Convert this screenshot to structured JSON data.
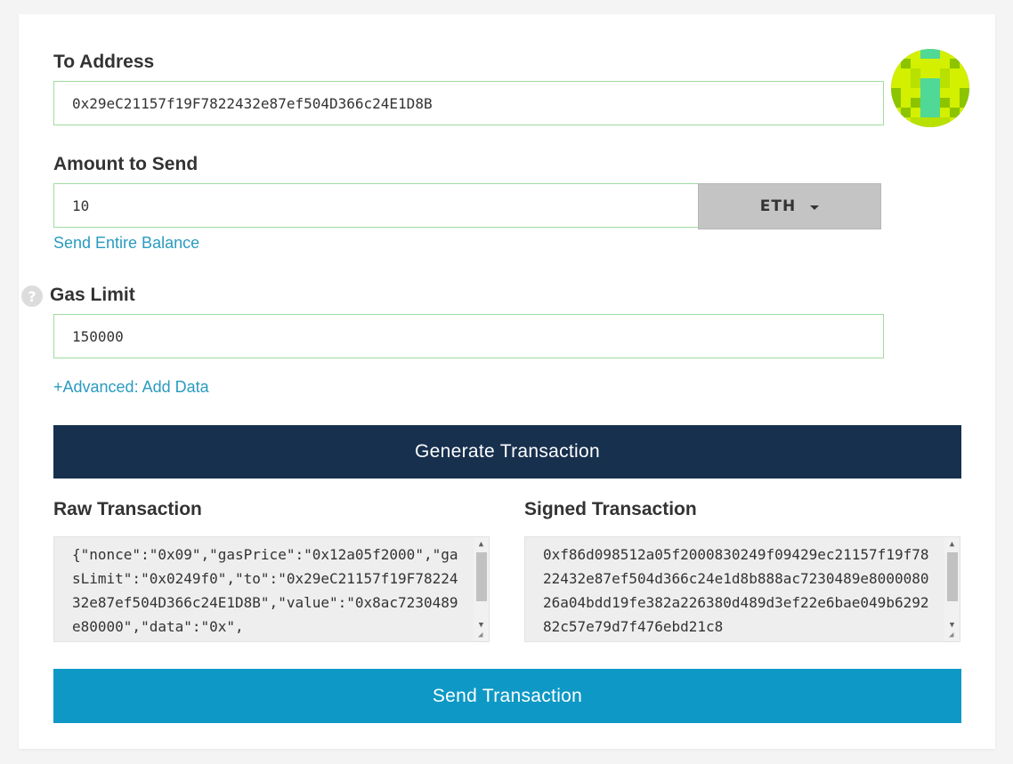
{
  "to_address": {
    "label": "To Address",
    "value": "0x29eC21157f19F7822432e87ef504D366c24E1D8B"
  },
  "amount": {
    "label": "Amount to Send",
    "value": "10",
    "unit": "ETH",
    "send_entire_balance": "Send Entire Balance"
  },
  "gas_limit": {
    "label": "Gas Limit",
    "help_icon": "?",
    "value": "150000",
    "advanced_link": "+Advanced: Add Data"
  },
  "generate_button": "Generate Transaction",
  "raw_tx": {
    "label": "Raw Transaction",
    "value": "{\"nonce\":\"0x09\",\"gasPrice\":\"0x12a05f2000\",\"gasLimit\":\"0x0249f0\",\"to\":\"0x29eC21157f19F7822432e87ef504D366c24E1D8B\",\"value\":\"0x8ac7230489e80000\",\"data\":\"0x\","
  },
  "signed_tx": {
    "label": "Signed Transaction",
    "value": "0xf86d098512a05f2000830249f09429ec21157f19f7822432e87ef504d366c24e1d8b888ac7230489e800008026a04bdd19fe382a226380d489d3ef22e6bae049b629282c57e79d7f476ebd21c8"
  },
  "send_button": "Send Transaction",
  "icons": {
    "help": "question-circle-icon",
    "dropdown": "caret-down-icon",
    "avatar": "identicon-avatar",
    "scroll_up": "▲",
    "scroll_down": "▼",
    "resize": "◢"
  },
  "colors": {
    "generate_button": "#17304e",
    "send_button": "#0e98c6",
    "link": "#2a9bc0",
    "input_border": "#9fdca0",
    "identicon_primary": "#d2f000",
    "identicon_secondary": "#8cc400",
    "identicon_accent": "#50d896"
  }
}
